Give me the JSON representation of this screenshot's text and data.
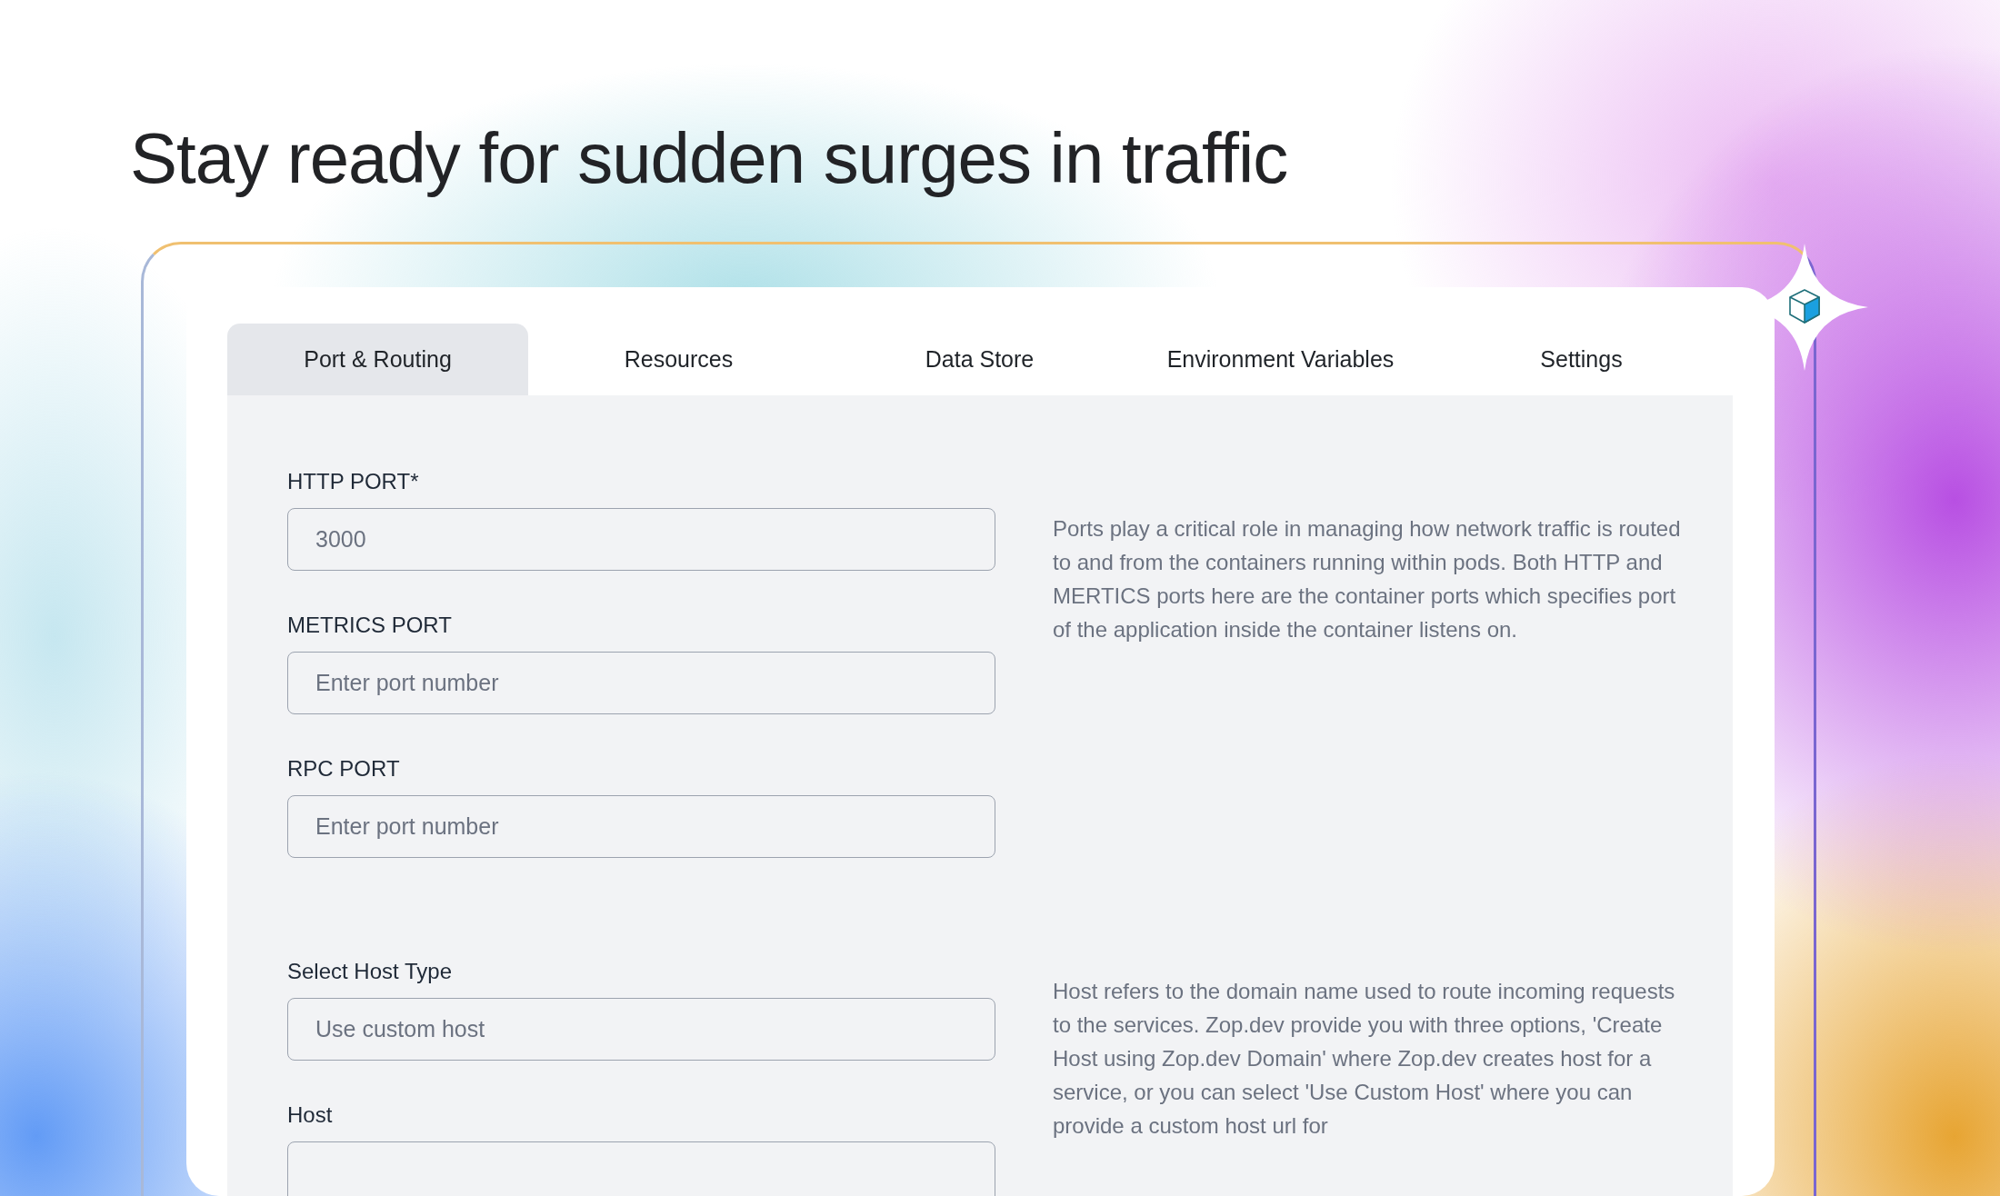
{
  "headline": "Stay ready for sudden surges in traffic",
  "tabs": [
    {
      "label": "Port & Routing",
      "selected": true
    },
    {
      "label": "Resources",
      "selected": false
    },
    {
      "label": "Data Store",
      "selected": false
    },
    {
      "label": "Environment Variables",
      "selected": false
    },
    {
      "label": "Settings",
      "selected": false
    }
  ],
  "sections": [
    {
      "fields": [
        {
          "label": "HTTP PORT*",
          "value": "3000"
        },
        {
          "label": "METRICS PORT",
          "placeholder": "Enter port number"
        },
        {
          "label": "RPC PORT",
          "placeholder": "Enter port number"
        }
      ],
      "description": "Ports play a critical role in managing how network traffic is routed to and from the containers running within pods. Both HTTP and MERTICS ports here are the container ports which specifies port of the application inside the container listens on."
    },
    {
      "fields": [
        {
          "label": "Select Host Type",
          "value": "Use custom host"
        },
        {
          "label": "Host"
        }
      ],
      "description": "Host refers to the domain name used to route incoming requests to the services. Zop.dev provide you with three options, 'Create Host using Zop.dev Domain' where Zop.dev creates host for a service, or you can select 'Use Custom Host' where you can provide a custom host url for"
    }
  ]
}
